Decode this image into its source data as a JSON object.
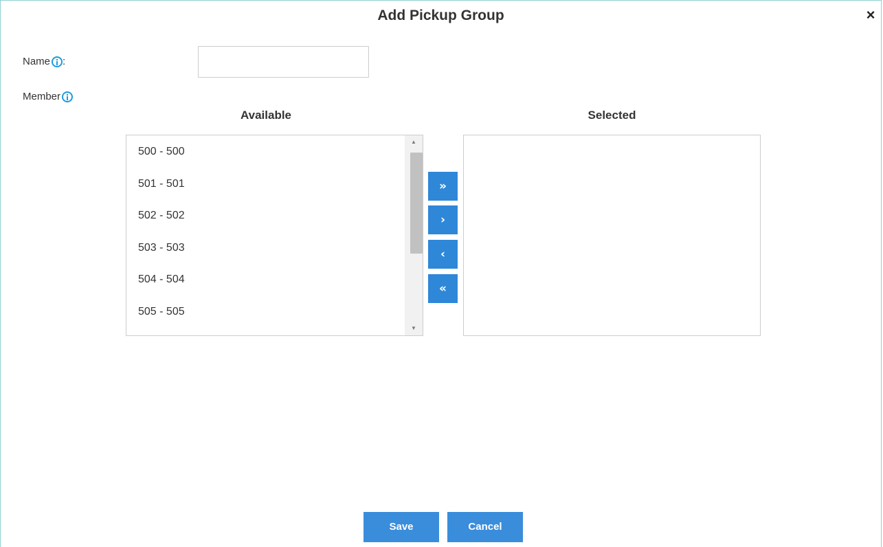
{
  "dialog": {
    "title": "Add Pickup Group",
    "close_glyph": "×"
  },
  "form": {
    "name_label": "Name",
    "name_colon": ":",
    "name_value": "",
    "name_placeholder": "",
    "member_label": "Member"
  },
  "members": {
    "available_header": "Available",
    "selected_header": "Selected",
    "available_items": [
      "500 - 500",
      "501 - 501",
      "502 - 502",
      "503 - 503",
      "504 - 504",
      "505 - 505"
    ],
    "selected_items": []
  },
  "move_buttons": {
    "add_all": "»",
    "add_one": "›",
    "remove_one": "‹",
    "remove_all": "«"
  },
  "footer": {
    "save_label": "Save",
    "cancel_label": "Cancel"
  },
  "colors": {
    "accent": "#2f87d8",
    "info_icon": "#1a9be0",
    "dialog_border": "#8fd0d4"
  },
  "icons": [
    "info-icon",
    "close-icon",
    "double-chevron-right-icon",
    "chevron-right-icon",
    "chevron-left-icon",
    "double-chevron-left-icon",
    "scroll-up-icon",
    "scroll-down-icon"
  ]
}
